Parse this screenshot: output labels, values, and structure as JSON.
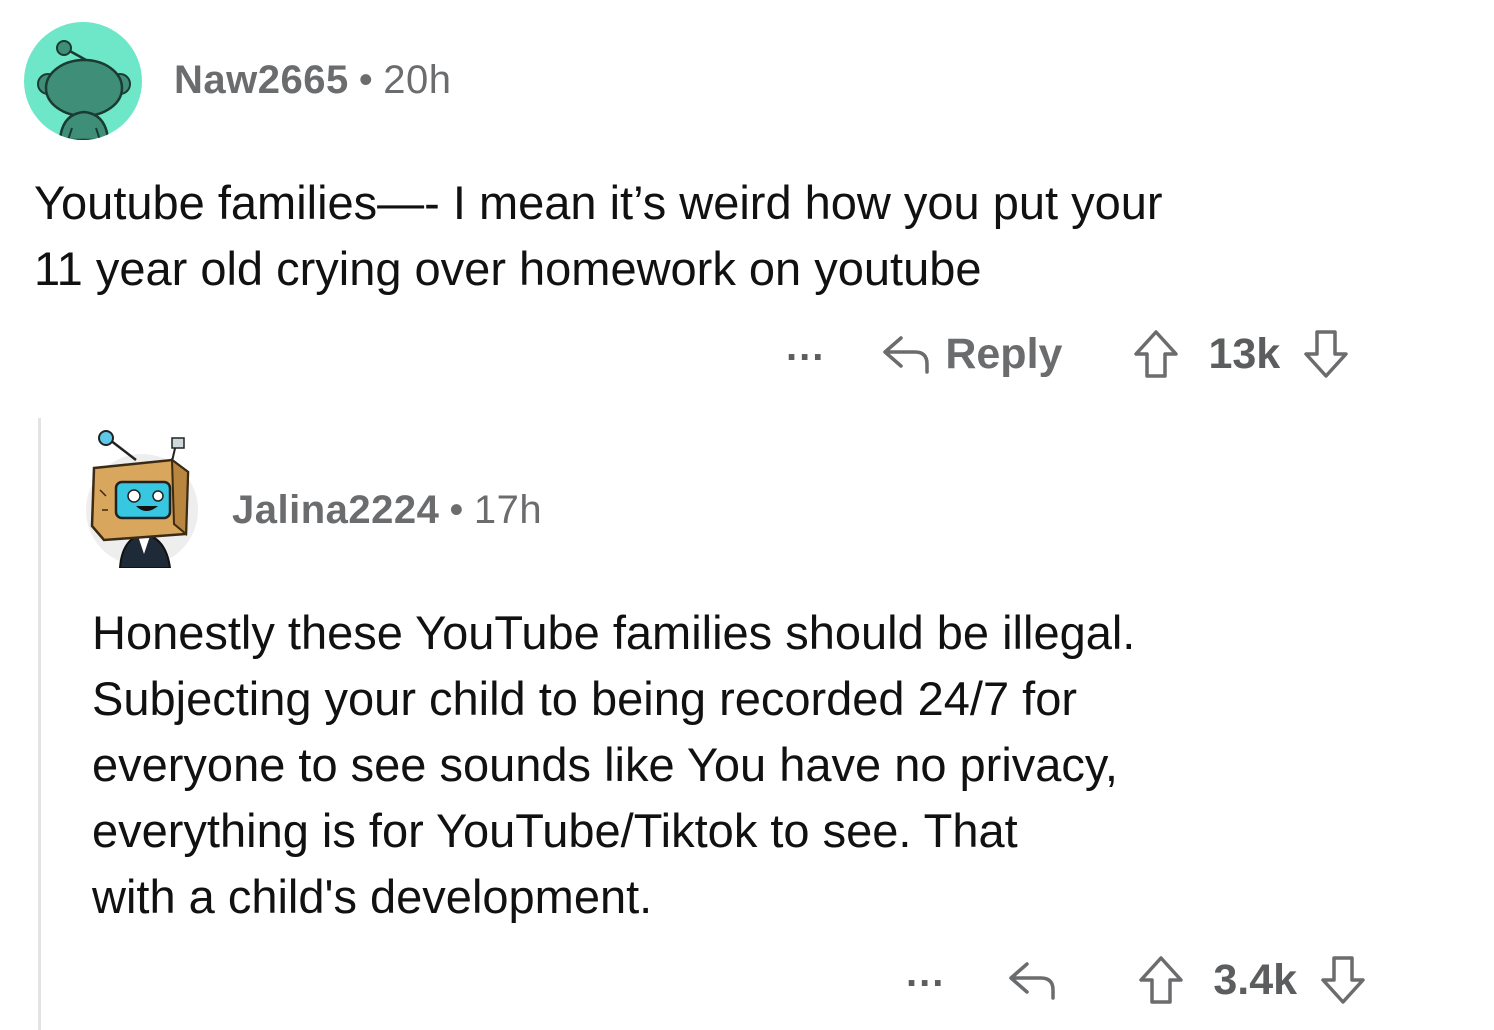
{
  "comments": [
    {
      "username": "Naw2665",
      "separator": "•",
      "time": "20h",
      "avatar_icon": "snoo-avatar-icon",
      "avatar_color": "#6ee6c8",
      "body": "Youtube families—- I mean it’s weird how you put your\n11 year old crying over homework on youtube",
      "more_label": "...",
      "reply_label": "Reply",
      "score": "13k"
    },
    {
      "username": "Jalina2224",
      "separator": "•",
      "time": "17h",
      "avatar_icon": "box-head-robot-avatar-icon",
      "body": "Honestly these YouTube families should be illegal.\nSubjecting your child to being recorded 24/7 for\neveryone to see sounds like          You have no privacy,\neverything is for YouTube/Tiktok to see. That\nwith a child's development.",
      "more_label": "...",
      "score": "3.4k"
    }
  ]
}
